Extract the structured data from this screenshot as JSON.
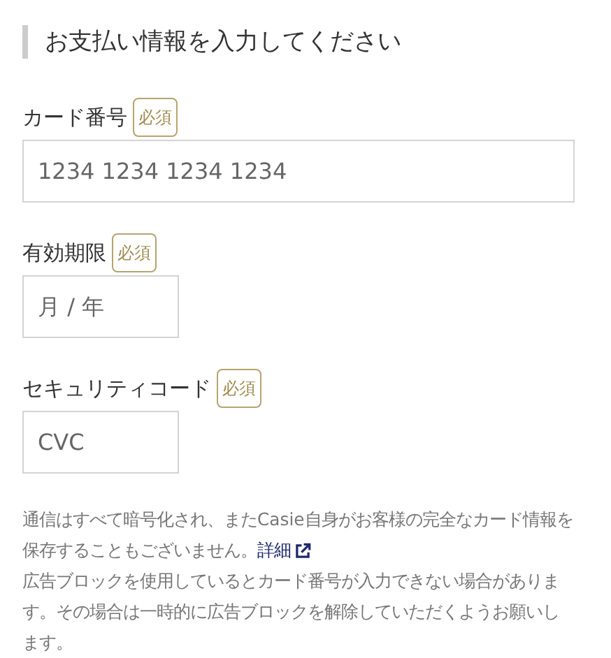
{
  "heading": "お支払い情報を入力してください",
  "fields": [
    {
      "label": "カード番号",
      "badge": "必須",
      "placeholder": "1234 1234 1234 1234",
      "kind": "wide"
    },
    {
      "label": "有効期限",
      "badge": "必須",
      "placeholder": "月 / 年",
      "kind": "short"
    },
    {
      "label": "セキュリティコード",
      "badge": "必須",
      "placeholder": "CVC",
      "kind": "short"
    }
  ],
  "notes": [
    {
      "text": "通信はすべて暗号化され、またCasie自身がお客様の完全なカード情報を保存することもございません。",
      "link": "詳細"
    },
    {
      "text": "広告ブロックを使用しているとカード番号が入力できない場合があります。その場合は一時的に広告ブロックを解除していただくようお願いします。"
    }
  ]
}
